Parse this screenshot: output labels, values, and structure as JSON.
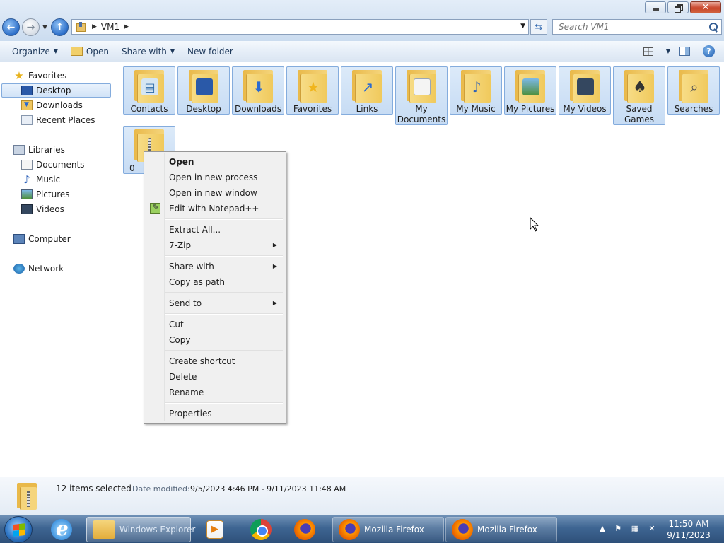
{
  "window": {
    "address_path": "VM1",
    "search_placeholder": "Search VM1"
  },
  "toolbar": {
    "organize_label": "Organize",
    "open_label": "Open",
    "share_label": "Share with",
    "new_folder_label": "New folder"
  },
  "navigation": {
    "favorites_label": "Favorites",
    "favorites": [
      {
        "label": "Desktop",
        "icon": "desktop-icon",
        "selected": true
      },
      {
        "label": "Downloads",
        "icon": "downloads-folder-icon"
      },
      {
        "label": "Recent Places",
        "icon": "recent-places-icon"
      }
    ],
    "libraries_label": "Libraries",
    "libraries": [
      {
        "label": "Documents",
        "icon": "documents-icon"
      },
      {
        "label": "Music",
        "icon": "music-icon"
      },
      {
        "label": "Pictures",
        "icon": "pictures-icon"
      },
      {
        "label": "Videos",
        "icon": "videos-icon"
      }
    ],
    "computer_label": "Computer",
    "network_label": "Network"
  },
  "files": [
    {
      "label": "Contacts",
      "icon": "contacts-folder-icon"
    },
    {
      "label": "Desktop",
      "icon": "desktop-folder-icon"
    },
    {
      "label": "Downloads",
      "icon": "downloads-folder-icon"
    },
    {
      "label": "Favorites",
      "icon": "favorites-folder-icon"
    },
    {
      "label": "Links",
      "icon": "links-folder-icon"
    },
    {
      "label": "My Documents",
      "icon": "documents-folder-icon"
    },
    {
      "label": "My Music",
      "icon": "music-folder-icon"
    },
    {
      "label": "My Pictures",
      "icon": "pictures-folder-icon"
    },
    {
      "label": "My Videos",
      "icon": "videos-folder-icon"
    },
    {
      "label": "Saved Games",
      "icon": "saved-games-folder-icon"
    },
    {
      "label": "Searches",
      "icon": "searches-folder-icon"
    },
    {
      "label": "0",
      "icon": "zip-folder-icon"
    }
  ],
  "context_menu": {
    "items": [
      {
        "label": "Open",
        "bold": true
      },
      {
        "label": "Open in new process"
      },
      {
        "label": "Open in new window"
      },
      {
        "label": "Edit with Notepad++",
        "icon": "notepadpp-icon"
      },
      {
        "label": "Extract All..."
      },
      {
        "label": "7-Zip",
        "submenu": true
      },
      {
        "label": "Share with",
        "submenu": true
      },
      {
        "label": "Copy as path"
      },
      {
        "label": "Send to",
        "submenu": true
      },
      {
        "label": "Cut"
      },
      {
        "label": "Copy"
      },
      {
        "label": "Create shortcut"
      },
      {
        "label": "Delete"
      },
      {
        "label": "Rename"
      },
      {
        "label": "Properties"
      }
    ]
  },
  "details": {
    "selection_count": "12 items selected",
    "date_modified_label": "Date modified:",
    "date_modified_value": "9/5/2023 4:46 PM - 9/11/2023 11:48 AM"
  },
  "taskbar": {
    "explorer_label": "Windows Explorer",
    "firefox1_label": "Mozilla Firefox",
    "firefox2_label": "Mozilla Firefox",
    "clock_time": "11:50 AM",
    "clock_date": "9/11/2023"
  },
  "colors": {
    "selection_fill": "#cde1f7",
    "selection_border": "#84acdd",
    "taskbar": "#3e6592"
  }
}
